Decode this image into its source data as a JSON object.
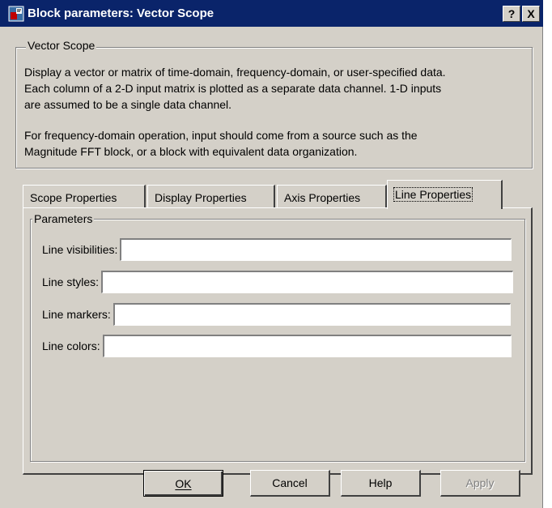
{
  "window": {
    "title": "Block parameters: Vector Scope",
    "help_button": "?",
    "close_button": "X"
  },
  "block_group": {
    "legend": "Vector Scope",
    "description_lines": [
      "Display a vector or matrix of time-domain, frequency-domain, or user-specified data.",
      "Each column of a 2-D input matrix is plotted as a separate data channel.  1-D inputs",
      "are assumed to be a single data channel.",
      "For frequency-domain operation, input should come from a source such as the",
      "Magnitude FFT block, or a block with equivalent data organization."
    ]
  },
  "tabs": [
    {
      "label": "Scope Properties",
      "active": false
    },
    {
      "label": "Display Properties",
      "active": false
    },
    {
      "label": "Axis Properties",
      "active": false
    },
    {
      "label": "Line Properties",
      "active": true
    }
  ],
  "parameters": {
    "legend": "Parameters",
    "fields": [
      {
        "label": "Line visibilities:",
        "value": ""
      },
      {
        "label": "Line styles:",
        "value": ""
      },
      {
        "label": "Line markers:",
        "value": ""
      },
      {
        "label": "Line colors:",
        "value": ""
      }
    ]
  },
  "buttons": {
    "ok": "OK",
    "cancel": "Cancel",
    "help": "Help",
    "apply": "Apply"
  },
  "colors": {
    "titlebar": "#0a246a",
    "face": "#d4d0c8"
  }
}
